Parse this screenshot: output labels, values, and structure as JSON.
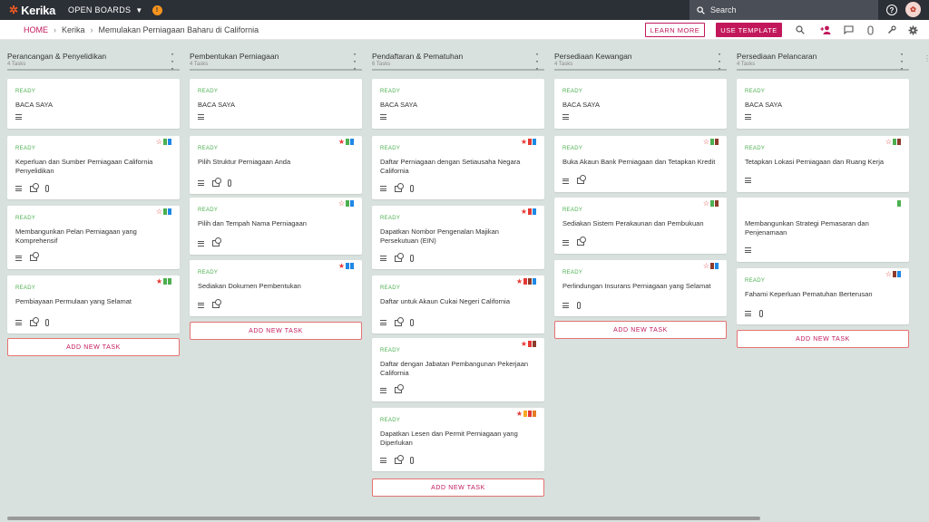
{
  "topbar": {
    "logo_text": "Kerika",
    "open_boards_label": "OPEN BOARDS",
    "search_placeholder": "Search"
  },
  "subbar": {
    "breadcrumb": [
      "HOME",
      "Kerika",
      "Memulakan Perniagaan Baharu di California"
    ],
    "learn_more": "LEARN MORE",
    "use_template": "USE TEMPLATE"
  },
  "colors": {
    "accent": "#c2185b",
    "ready": "#4caf50",
    "topbar": "#2b2f36",
    "background": "#d8e1dd"
  },
  "columns": [
    {
      "title": "Perancangan & Penyelidikan",
      "count": "4 Tasks",
      "add_label": "ADD NEW TASK",
      "cards": [
        {
          "status": "READY",
          "title": "BACA SAYA",
          "icons": [
            "desc"
          ],
          "flags": []
        },
        {
          "status": "READY",
          "title": "Keperluan dan Sumber Perniagaan California Penyelidikan",
          "icons": [
            "desc",
            "check",
            "clip"
          ],
          "flags": [
            "star-outline",
            "#4caf50",
            "#1e88e5"
          ]
        },
        {
          "status": "READY",
          "title": "Membangunkan Pelan Perniagaan yang Komprehensif",
          "icons": [
            "desc",
            "check"
          ],
          "flags": [
            "star-outline",
            "#4caf50",
            "#1e88e5"
          ]
        },
        {
          "status": "READY",
          "title": "Pembiayaan Permulaan yang Selamat",
          "icons": [
            "desc",
            "check",
            "clip"
          ],
          "flags": [
            "star",
            "#4caf50",
            "#4caf50"
          ]
        }
      ]
    },
    {
      "title": "Pembentukan Perniagaan",
      "count": "4 Tasks",
      "add_label": "ADD NEW TASK",
      "cards": [
        {
          "status": "READY",
          "title": "BACA SAYA",
          "icons": [
            "desc"
          ],
          "flags": []
        },
        {
          "status": "READY",
          "title": "Pilih Struktur Perniagaan Anda",
          "icons": [
            "desc",
            "check",
            "clip"
          ],
          "flags": [
            "star",
            "#4caf50",
            "#1e88e5"
          ]
        },
        {
          "status": "READY",
          "title": "Pilih dan Tempah Nama Perniagaan",
          "icons": [
            "desc",
            "check"
          ],
          "flags": [
            "star-outline",
            "#4caf50",
            "#1e88e5"
          ]
        },
        {
          "status": "READY",
          "title": "Sediakan Dokumen Pembentukan",
          "icons": [
            "desc",
            "check"
          ],
          "flags": [
            "star",
            "#1e88e5",
            "#1e88e5"
          ]
        }
      ]
    },
    {
      "title": "Pendaftaran & Pematuhan",
      "count": "6 Tasks",
      "add_label": "ADD NEW TASK",
      "cards": [
        {
          "status": "READY",
          "title": "BACA SAYA",
          "icons": [
            "desc"
          ],
          "flags": []
        },
        {
          "status": "READY",
          "title": "Daftar Perniagaan dengan Setiausaha Negara California",
          "icons": [
            "desc",
            "check",
            "clip"
          ],
          "flags": [
            "star",
            "#e53935",
            "#1e88e5"
          ]
        },
        {
          "status": "READY",
          "title": "Dapatkan Nombor Pengenalan Majikan Persekutuan (EIN)",
          "icons": [
            "desc",
            "check",
            "clip"
          ],
          "flags": [
            "star",
            "#e53935",
            "#1e88e5"
          ]
        },
        {
          "status": "READY",
          "title": "Daftar untuk Akaun Cukai Negeri California",
          "icons": [
            "desc",
            "check",
            "clip"
          ],
          "flags": [
            "star",
            "#e53935",
            "#8d3b2b",
            "#1e88e5"
          ]
        },
        {
          "status": "READY",
          "title": "Daftar dengan Jabatan Pembangunan Pekerjaan California",
          "icons": [
            "desc",
            "check"
          ],
          "flags": [
            "star",
            "#e53935",
            "#8d3b2b"
          ]
        },
        {
          "status": "READY",
          "title": "Dapatkan Lesen dan Permit Perniagaan yang Diperlukan",
          "icons": [
            "desc",
            "check",
            "clip"
          ],
          "flags": [
            "star",
            "#f9a825",
            "#e53935",
            "#e57c24"
          ]
        }
      ]
    },
    {
      "title": "Persediaan Kewangan",
      "count": "4 Tasks",
      "add_label": "ADD NEW TASK",
      "cards": [
        {
          "status": "READY",
          "title": "BACA SAYA",
          "icons": [
            "desc"
          ],
          "flags": []
        },
        {
          "status": "READY",
          "title": "Buka Akaun Bank Perniagaan dan Tetapkan Kredit",
          "icons": [
            "desc",
            "check"
          ],
          "flags": [
            "star-outline",
            "#4caf50",
            "#8d3b2b"
          ]
        },
        {
          "status": "READY",
          "title": "Sediakan Sistem Perakaunan dan Pembukuan",
          "icons": [
            "desc",
            "check"
          ],
          "flags": [
            "star-outline",
            "#4caf50",
            "#8d3b2b"
          ]
        },
        {
          "status": "READY",
          "title": "Perlindungan Insurans Perniagaan yang Selamat",
          "icons": [
            "desc",
            "clip"
          ],
          "flags": [
            "star-outline",
            "#8d3b2b",
            "#1e88e5"
          ]
        }
      ]
    },
    {
      "title": "Persediaan Pelancaran",
      "count": "4 Tasks",
      "add_label": "ADD NEW TASK",
      "cards": [
        {
          "status": "READY",
          "title": "BACA SAYA",
          "icons": [
            "desc"
          ],
          "flags": []
        },
        {
          "status": "READY",
          "title": "Tetapkan Lokasi Perniagaan dan Ruang Kerja",
          "icons": [
            "desc"
          ],
          "flags": [
            "star-outline",
            "#4caf50",
            "#8d3b2b"
          ]
        },
        {
          "status": "",
          "title": "Membangunkan Strategi Pemasaran dan Penjenamaan",
          "icons": [
            "desc"
          ],
          "flags": [
            "#4caf50"
          ]
        },
        {
          "status": "READY",
          "title": "Fahami Keperluan Pematuhan Berterusan",
          "icons": [
            "desc",
            "clip"
          ],
          "flags": [
            "star-outline",
            "#8d3b2b",
            "#1e88e5"
          ]
        }
      ]
    }
  ]
}
